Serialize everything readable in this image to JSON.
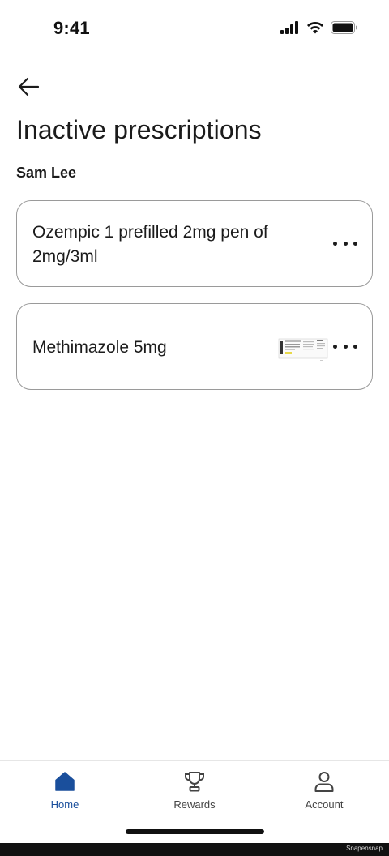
{
  "status_bar": {
    "time": "9:41"
  },
  "header": {
    "back_label": "",
    "title": "Inactive prescriptions",
    "patient": "Sam Lee"
  },
  "prescriptions": [
    {
      "name": "Ozempic 1 prefilled 2mg pen of 2mg/3ml",
      "has_label_image": false
    },
    {
      "name": "Methimazole 5mg",
      "has_label_image": true
    }
  ],
  "bottom_nav": {
    "items": [
      {
        "label": "Home",
        "icon": "home-icon",
        "active": true
      },
      {
        "label": "Rewards",
        "icon": "trophy-icon",
        "active": false
      },
      {
        "label": "Account",
        "icon": "person-icon",
        "active": false
      }
    ]
  },
  "watermark": "Snapensnap",
  "colors": {
    "accent": "#1a4f9c",
    "text": "#1b1b1b",
    "border": "#9a9a9a"
  }
}
